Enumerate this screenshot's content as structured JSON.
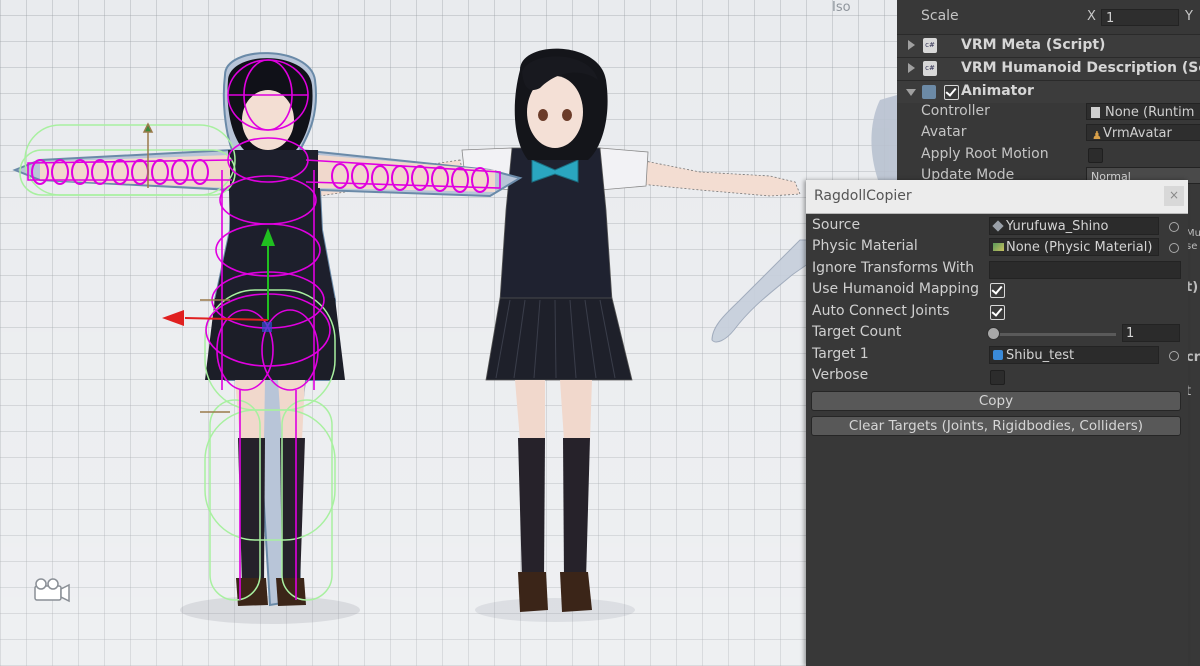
{
  "scene": {
    "view_label": "Iso"
  },
  "inspector": {
    "top_row_label": "Scale",
    "scale_x_label": "X",
    "scale_x_value": "1",
    "scale_y_label": "Y",
    "components": [
      {
        "title": "VRM Meta (Script)",
        "icon": "script-icon"
      },
      {
        "title": "VRM Humanoid Description (Scri",
        "icon": "script-icon"
      }
    ],
    "animator": {
      "title": "Animator",
      "controller_label": "Controller",
      "controller_value": "None (Runtim",
      "avatar_label": "Avatar",
      "avatar_value": "VrmAvatar",
      "apply_root_motion_label": "Apply Root Motion",
      "update_mode_label": "Update Mode",
      "update_mode_value": "Normal"
    },
    "edge_fragments": [
      "Mu",
      "se",
      "t)",
      "cri",
      "t"
    ]
  },
  "ragdoll": {
    "title": "RagdollCopier",
    "close": "×",
    "source_label": "Source",
    "source_value": "Yurufuwa_Shino",
    "physic_material_label": "Physic Material",
    "physic_material_value": "None (Physic Material)",
    "ignore_transforms_label": "Ignore Transforms With",
    "use_humanoid_label": "Use Humanoid Mapping",
    "use_humanoid_checked": true,
    "auto_connect_label": "Auto Connect Joints",
    "auto_connect_checked": true,
    "target_count_label": "Target Count",
    "target_count_value": "1",
    "target1_label": "Target 1",
    "target1_value": "Shibu_test",
    "verbose_label": "Verbose",
    "verbose_checked": false,
    "copy_button": "Copy",
    "clear_button": "Clear Targets (Joints, Rigidbodies, Colliders)"
  },
  "colors": {
    "inspector_bg": "#383838",
    "joint_magenta": "#e000e0",
    "collider_green": "#a8f0a0",
    "gizmo_red": "#e02020",
    "gizmo_green": "#20c020"
  }
}
